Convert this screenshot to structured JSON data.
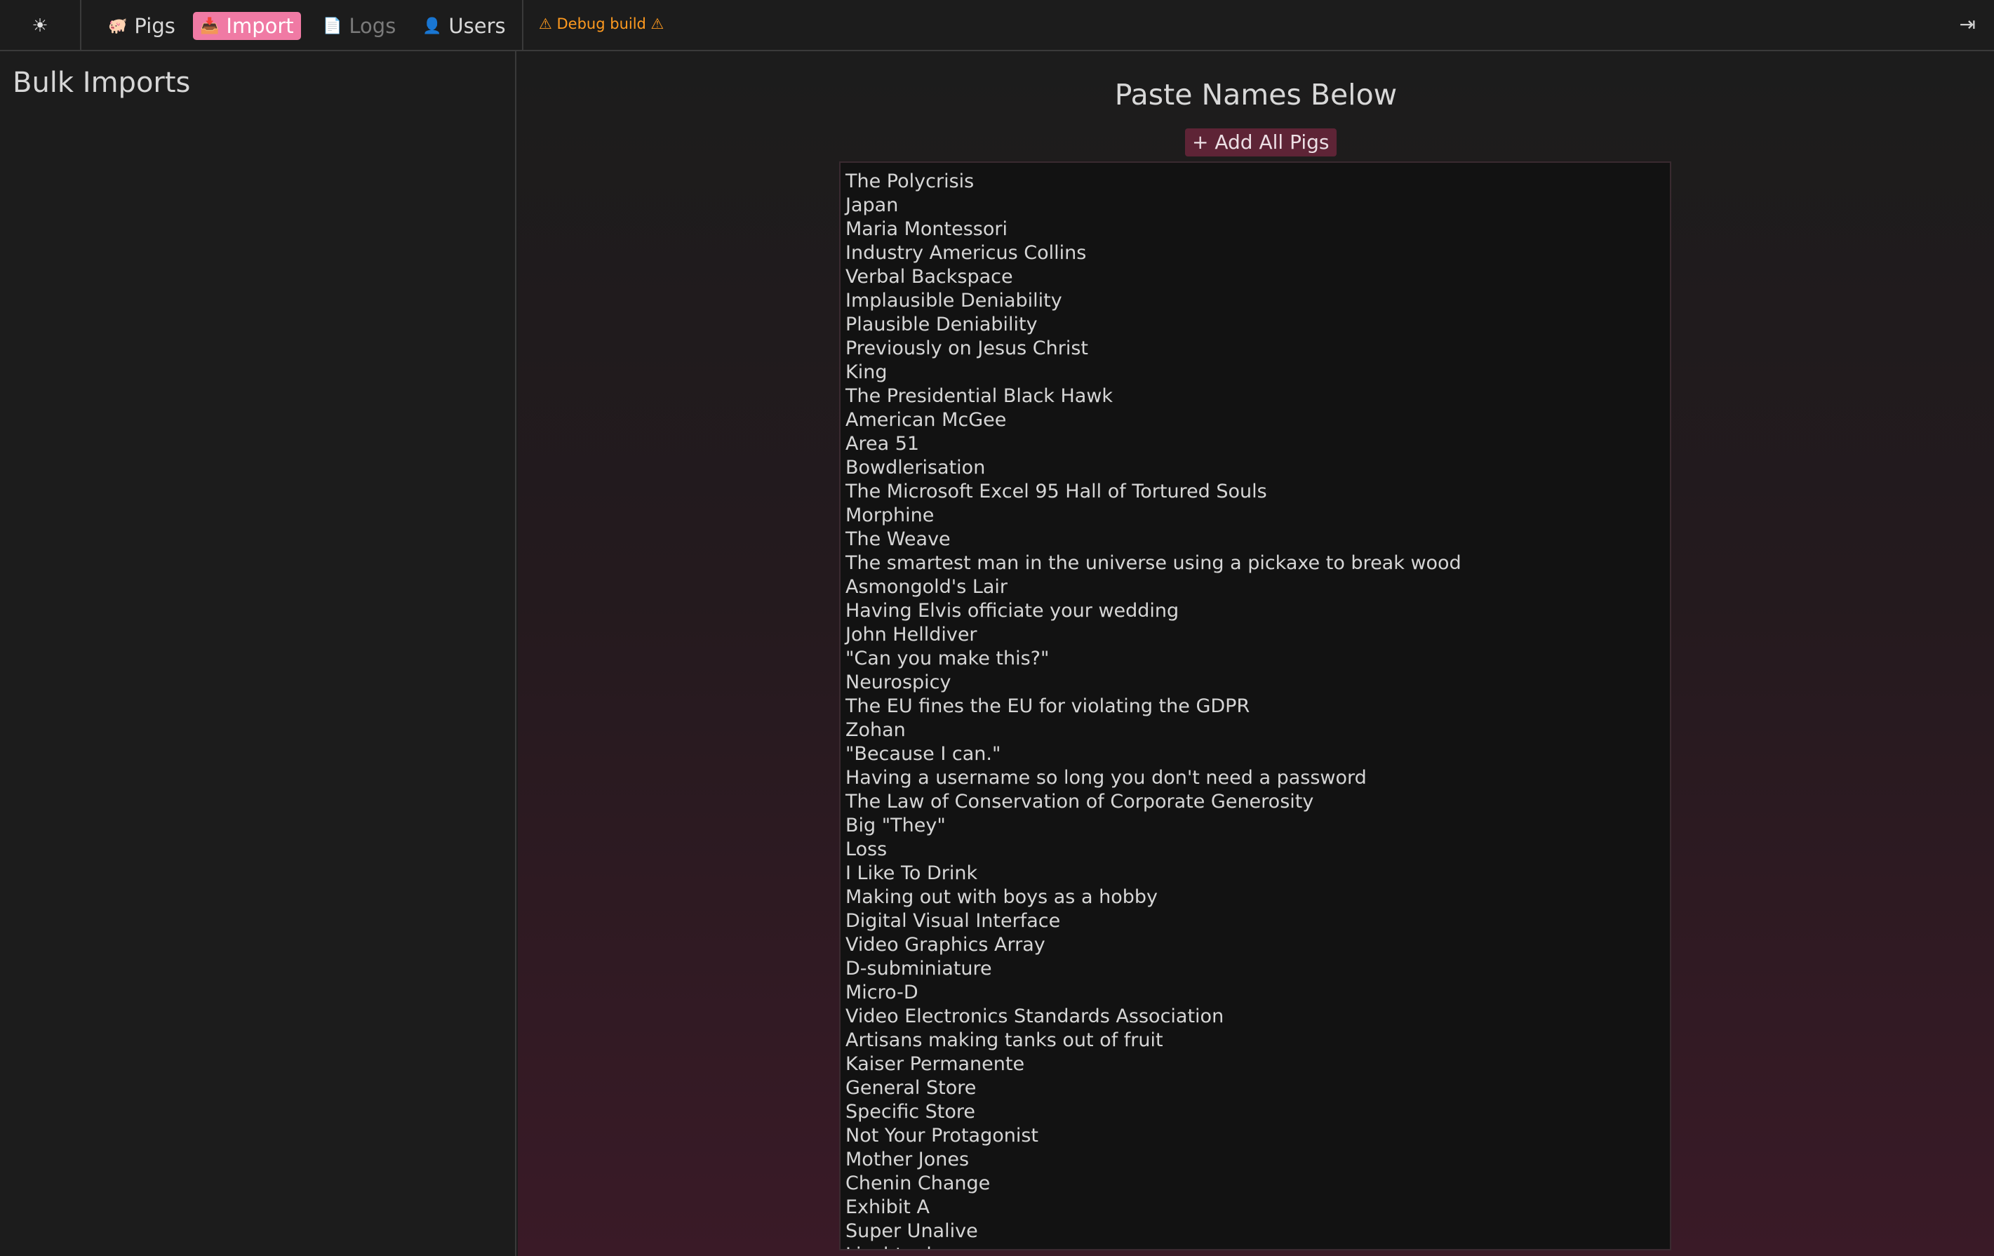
{
  "topbar": {
    "theme_icon": "sun-icon",
    "theme_glyph": "☀",
    "nav": [
      {
        "label": "Pigs",
        "icon": "pig-icon",
        "glyph": "🐖"
      },
      {
        "label": "Import",
        "icon": "import-icon",
        "glyph": "📥"
      },
      {
        "label": "Logs",
        "icon": "logs-icon",
        "glyph": "📄"
      },
      {
        "label": "Users",
        "icon": "users-icon",
        "glyph": "👤"
      }
    ],
    "debug_label": "⚠ Debug build ⚠",
    "logout_icon": "logout-icon",
    "logout_glyph": "⇥"
  },
  "sidebar": {
    "title": "Bulk Imports"
  },
  "main": {
    "title": "Paste Names Below",
    "add_button_label": "+ Add All Pigs",
    "names_text": "The Polycrisis\nJapan\nMaria Montessori\nIndustry Americus Collins\nVerbal Backspace\nImplausible Deniability\nPlausible Deniability\nPreviously on Jesus Christ\nKing\nThe Presidential Black Hawk\nAmerican McGee\nArea 51\nBowdlerisation\nThe Microsoft Excel 95 Hall of Tortured Souls\nMorphine\nThe Weave\nThe smartest man in the universe using a pickaxe to break wood\nAsmongold's Lair\nHaving Elvis officiate your wedding\nJohn Helldiver\n\"Can you make this?\"\nNeurospicy\nThe EU fines the EU for violating the GDPR\nZohan\n\"Because I can.\"\nHaving a username so long you don't need a password\nThe Law of Conservation of Corporate Generosity\nBig \"They\"\nLoss\nI Like To Drink\nMaking out with boys as a hobby\nDigital Visual Interface\nVideo Graphics Array\nD-subminiature\nMicro-D\nVideo Electronics Standards Association\nArtisans making tanks out of fruit\nKaiser Permanente\nGeneral Store\nSpecific Store\nNot Your Protagonist\nMother Jones\nChenin Change\nExhibit A\nSuper Unalive\nLiechtenbourg"
  },
  "colors": {
    "accent": "#f07aa4",
    "button_bg": "#5e2436",
    "warning": "#ff9a1f",
    "background": "#1c1c1c"
  }
}
